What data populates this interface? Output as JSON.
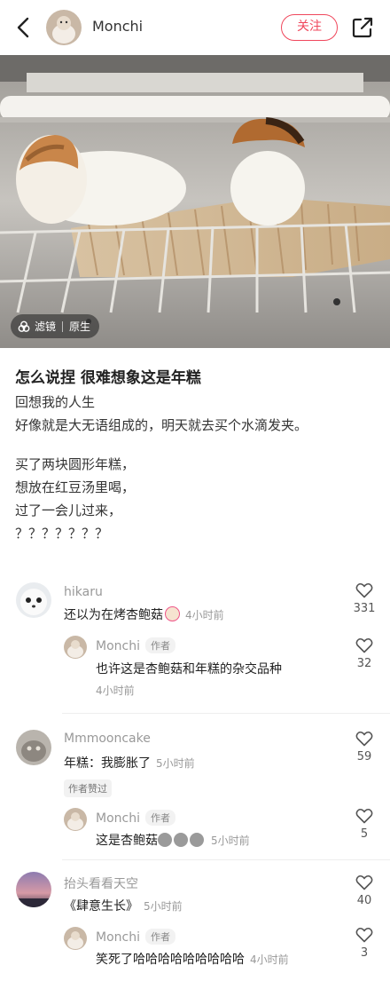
{
  "header": {
    "author": "Monchi",
    "follow_label": "关注"
  },
  "photo": {
    "filter_label": "滤镜",
    "original_label": "原生"
  },
  "post": {
    "title": "怎么说捏 很难想象这是年糕",
    "lines1": [
      "回想我的人生",
      "好像就是大无语组成的，明天就去买个水滴发夹。"
    ],
    "lines2": [
      "买了两块圆形年糕，",
      "想放在红豆汤里喝，",
      "过了一会儿过来，",
      "？？？？？？？"
    ]
  },
  "comments": [
    {
      "name": "hikaru",
      "text": "还以为在烤杏鲍菇",
      "time": "4小时前",
      "likes": "331",
      "reply": {
        "name": "Monchi",
        "badge": "作者",
        "text": "也许这是杏鲍菇和年糕的杂交品种",
        "time": "4小时前",
        "likes": "32"
      }
    },
    {
      "name": "Mmmooncake",
      "text": "年糕：我膨胀了",
      "time": "5小时前",
      "likes": "59",
      "liked_badge": "作者赞过",
      "reply": {
        "name": "Monchi",
        "badge": "作者",
        "text": "这是杏鲍菇",
        "time": "5小时前",
        "likes": "5"
      }
    },
    {
      "name": "抬头看看天空",
      "text": "《肆意生长》",
      "time": "5小时前",
      "likes": "40",
      "reply": {
        "name": "Monchi",
        "badge": "作者",
        "text": "笑死了哈哈哈哈哈哈哈哈哈",
        "time": "4小时前",
        "likes": "3"
      }
    }
  ],
  "colors": {
    "accent": "#f0475c"
  }
}
